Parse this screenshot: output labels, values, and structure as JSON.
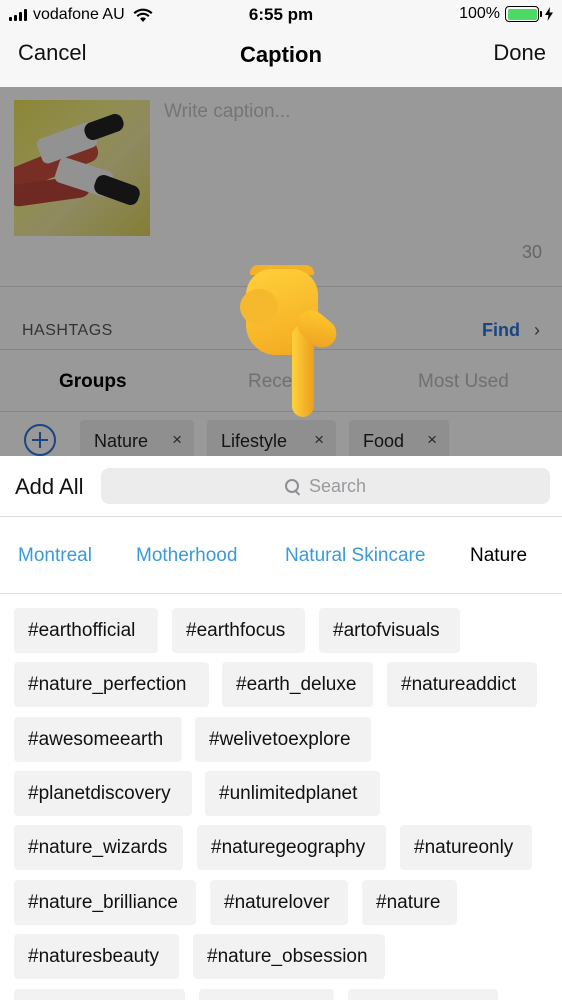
{
  "status_bar": {
    "carrier": "vodafone AU",
    "time": "6:55 pm",
    "battery_percent": "100%",
    "battery_level": 1.0,
    "signal_bars": 4
  },
  "nav": {
    "cancel_label": "Cancel",
    "title": "Caption",
    "done_label": "Done"
  },
  "caption": {
    "placeholder": "Write caption...",
    "char_count": "30"
  },
  "hashtags": {
    "section_label": "HASHTAGS",
    "find_label": "Find",
    "find_chevron": "›",
    "tabs": [
      {
        "label": "Groups",
        "active": true
      },
      {
        "label": "Rece",
        "active": false
      },
      {
        "label": "Most Used",
        "active": false
      }
    ],
    "groups": [
      {
        "label": "Nature",
        "remove": "×"
      },
      {
        "label": "Lifestyle",
        "remove": "×"
      },
      {
        "label": "Food",
        "remove": "×"
      }
    ]
  },
  "sheet": {
    "add_all_label": "Add All",
    "search_placeholder": "Search",
    "categories": [
      {
        "label": "Montreal",
        "active": false
      },
      {
        "label": "Motherhood",
        "active": false
      },
      {
        "label": "Natural Skincare",
        "active": false
      },
      {
        "label": "Nature",
        "active": true
      }
    ],
    "tags": [
      "#earthofficial",
      "#earthfocus",
      "#artofvisuals",
      "#nature_perfection",
      "#earth_deluxe",
      "#natureaddict",
      "#awesomeearth",
      "#welivetoexplore",
      "#planetdiscovery",
      "#unlimitedplanet",
      "#nature_wizards",
      "#naturegeography",
      "#natureonly",
      "#nature_brilliance",
      "#naturelover",
      "#nature",
      "#naturesbeauty",
      "#nature_obsession"
    ]
  },
  "colors": {
    "accent_blue": "#2d72d9",
    "category_blue": "#3a9ad9",
    "battery_green": "#4cd964",
    "chip_bg": "#f2f2f2"
  },
  "icons": [
    "signal-icon",
    "wifi-icon",
    "battery-icon",
    "charging-icon",
    "chevron-right-icon",
    "add-circle-icon",
    "close-icon",
    "search-icon",
    "pointing-hand-icon"
  ]
}
